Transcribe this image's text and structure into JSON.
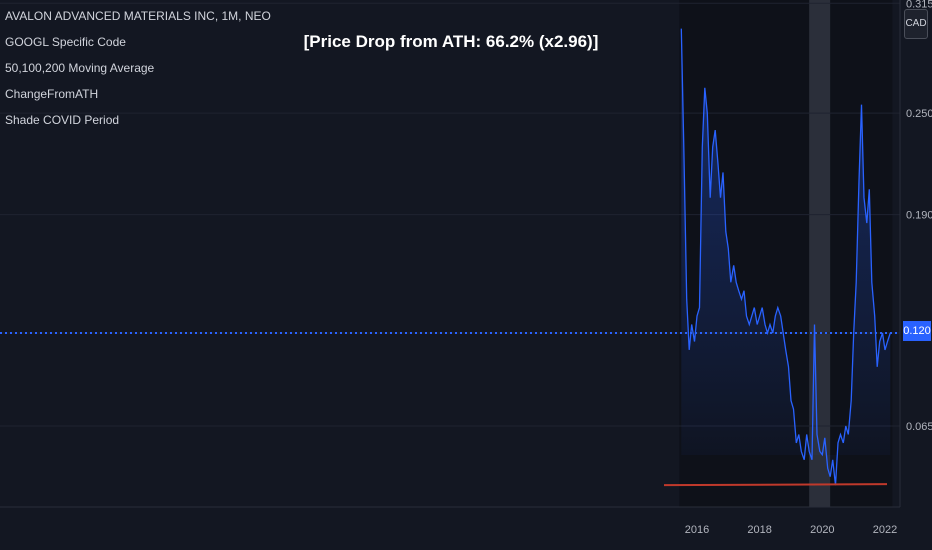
{
  "legend": [
    "AVALON ADVANCED MATERIALS INC, 1M, NEO",
    "GOOGL Specific Code",
    "50,100,200 Moving Average",
    "ChangeFromATH",
    "Shade COVID Period"
  ],
  "annotation": "[Price Drop from ATH: 66.2% (x2.96)]",
  "currency": "CAD",
  "last_price_label": "0.120",
  "colors": {
    "background": "#131722",
    "line": "#2962ff",
    "area_top": "#2962ff",
    "ath_line": "#c0392b",
    "price_dotted": "#2962ff",
    "covid_shade": "#363a45",
    "grid": "#1e222d"
  },
  "chart_data": {
    "type": "area",
    "title": "",
    "xlabel": "",
    "ylabel": "",
    "x_ticks": [
      "2016",
      "2018",
      "2020",
      "2022"
    ],
    "y_ticks": [
      "0.065",
      "0.120",
      "0.190",
      "0.250",
      "0.315"
    ],
    "ylim": [
      0.0,
      0.315
    ],
    "grid": true,
    "series": [
      {
        "values": [
          [
            2015.5,
            0.3
          ],
          [
            2015.58,
            0.23
          ],
          [
            2015.67,
            0.14
          ],
          [
            2015.75,
            0.11
          ],
          [
            2015.83,
            0.125
          ],
          [
            2015.92,
            0.115
          ],
          [
            2016.0,
            0.13
          ],
          [
            2016.08,
            0.135
          ],
          [
            2016.17,
            0.23
          ],
          [
            2016.25,
            0.265
          ],
          [
            2016.33,
            0.25
          ],
          [
            2016.42,
            0.2
          ],
          [
            2016.5,
            0.23
          ],
          [
            2016.58,
            0.24
          ],
          [
            2016.67,
            0.22
          ],
          [
            2016.75,
            0.2
          ],
          [
            2016.83,
            0.215
          ],
          [
            2016.92,
            0.18
          ],
          [
            2017.0,
            0.17
          ],
          [
            2017.08,
            0.15
          ],
          [
            2017.17,
            0.16
          ],
          [
            2017.25,
            0.15
          ],
          [
            2017.33,
            0.145
          ],
          [
            2017.42,
            0.14
          ],
          [
            2017.5,
            0.145
          ],
          [
            2017.58,
            0.13
          ],
          [
            2017.67,
            0.125
          ],
          [
            2017.75,
            0.13
          ],
          [
            2017.83,
            0.135
          ],
          [
            2017.92,
            0.125
          ],
          [
            2018.0,
            0.13
          ],
          [
            2018.08,
            0.135
          ],
          [
            2018.17,
            0.125
          ],
          [
            2018.25,
            0.12
          ],
          [
            2018.33,
            0.125
          ],
          [
            2018.42,
            0.12
          ],
          [
            2018.5,
            0.13
          ],
          [
            2018.58,
            0.135
          ],
          [
            2018.67,
            0.13
          ],
          [
            2018.75,
            0.12
          ],
          [
            2018.83,
            0.11
          ],
          [
            2018.92,
            0.1
          ],
          [
            2019.0,
            0.08
          ],
          [
            2019.08,
            0.075
          ],
          [
            2019.17,
            0.055
          ],
          [
            2019.25,
            0.06
          ],
          [
            2019.33,
            0.05
          ],
          [
            2019.42,
            0.045
          ],
          [
            2019.5,
            0.06
          ],
          [
            2019.58,
            0.05
          ],
          [
            2019.67,
            0.045
          ],
          [
            2019.75,
            0.125
          ],
          [
            2019.83,
            0.06
          ],
          [
            2019.92,
            0.05
          ],
          [
            2020.0,
            0.048
          ],
          [
            2020.08,
            0.058
          ],
          [
            2020.17,
            0.04
          ],
          [
            2020.25,
            0.035
          ],
          [
            2020.33,
            0.045
          ],
          [
            2020.42,
            0.03
          ],
          [
            2020.5,
            0.055
          ],
          [
            2020.58,
            0.06
          ],
          [
            2020.67,
            0.055
          ],
          [
            2020.75,
            0.065
          ],
          [
            2020.83,
            0.06
          ],
          [
            2020.92,
            0.08
          ],
          [
            2021.0,
            0.12
          ],
          [
            2021.08,
            0.15
          ],
          [
            2021.17,
            0.21
          ],
          [
            2021.25,
            0.255
          ],
          [
            2021.33,
            0.2
          ],
          [
            2021.42,
            0.185
          ],
          [
            2021.5,
            0.205
          ],
          [
            2021.58,
            0.15
          ],
          [
            2021.67,
            0.13
          ],
          [
            2021.75,
            0.1
          ],
          [
            2021.83,
            0.115
          ],
          [
            2021.92,
            0.12
          ],
          [
            2022.0,
            0.11
          ],
          [
            2022.08,
            0.115
          ],
          [
            2022.17,
            0.12
          ]
        ]
      }
    ],
    "covid_shade": [
      2019.58,
      2020.25
    ],
    "ath_reference_line": 0.03,
    "last_price": 0.12
  }
}
